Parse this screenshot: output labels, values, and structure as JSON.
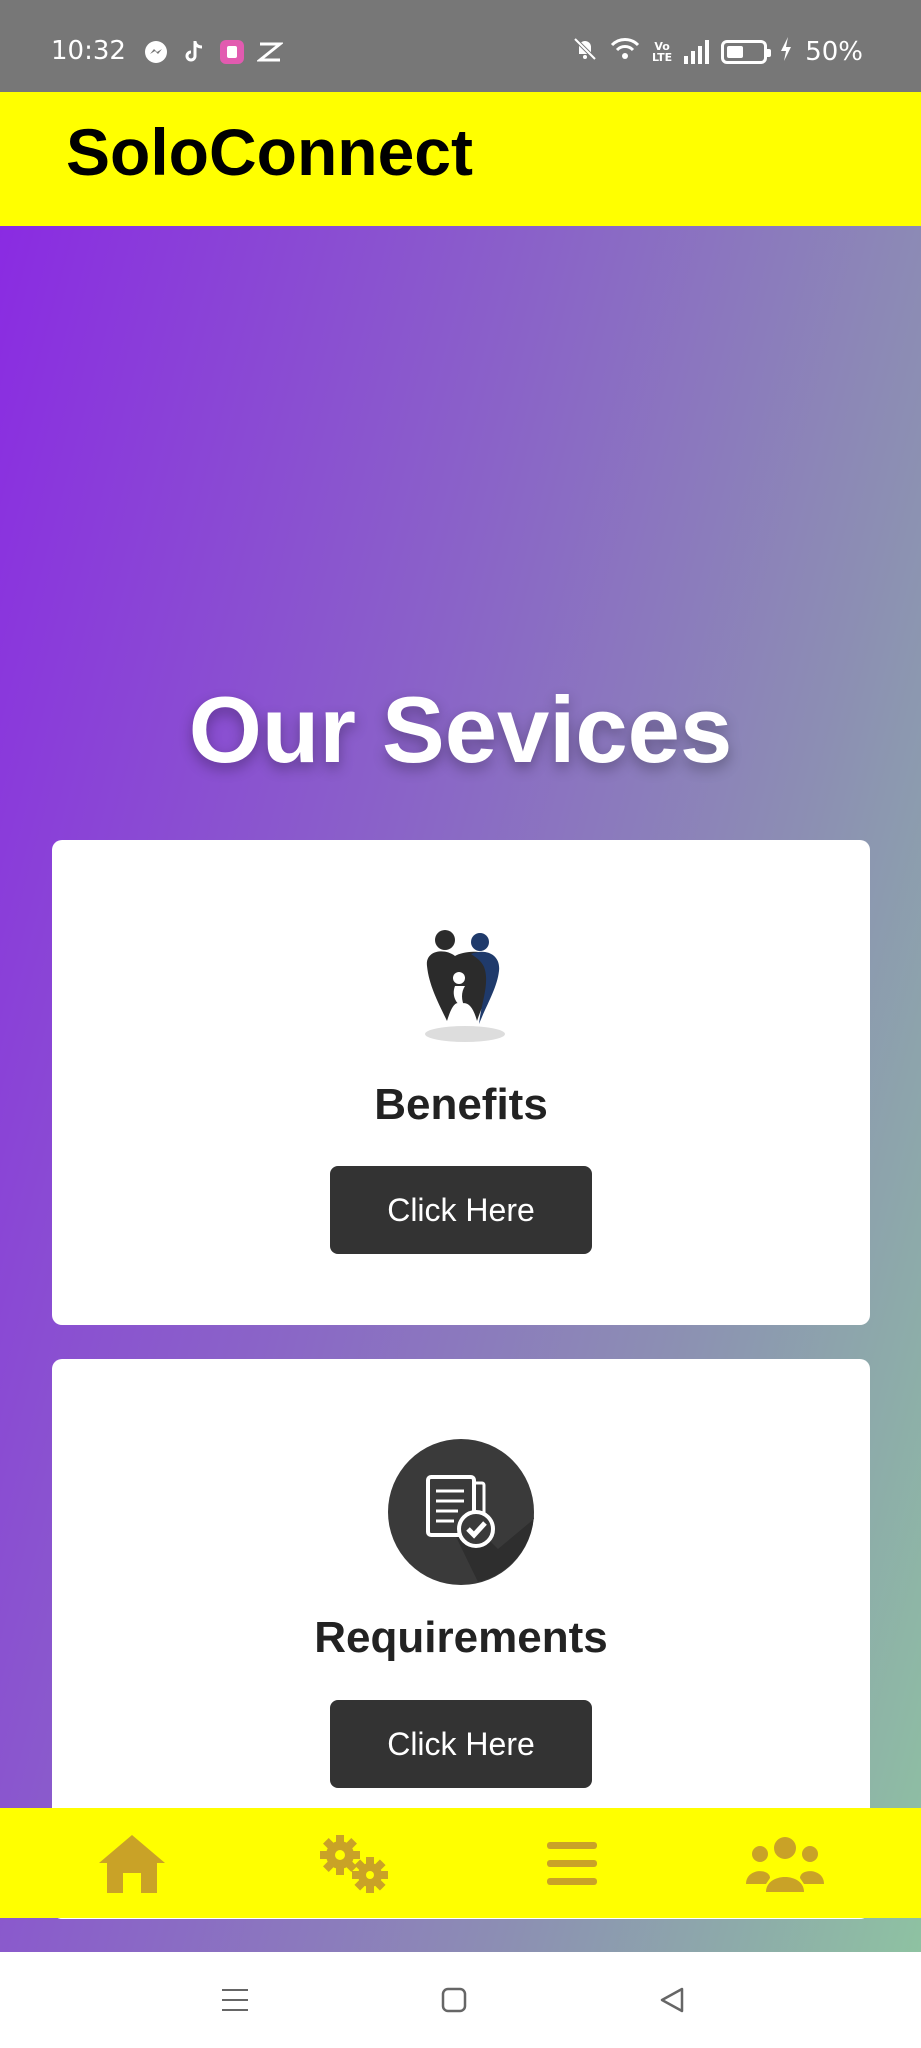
{
  "status_bar": {
    "time": "10:32",
    "battery_percent": "50%",
    "network_label": "Vo\nLTE",
    "notification_icons": [
      "messenger-icon",
      "tiktok-icon",
      "app-icon",
      "capcut-icon"
    ],
    "system_icons": [
      "mute-icon",
      "wifi-icon",
      "volte-icon",
      "signal-icon",
      "battery-icon",
      "charging-icon"
    ]
  },
  "header": {
    "title": "SoloConnect",
    "background_color": "#ffff00"
  },
  "main": {
    "section_title": "Our Sevices",
    "cards": [
      {
        "icon": "family-tooth-icon",
        "label": "Benefits",
        "button_label": "Click Here"
      },
      {
        "icon": "document-check-icon",
        "label": "Requirements",
        "button_label": "Click Here"
      }
    ]
  },
  "bottom_nav": {
    "items": [
      {
        "icon": "home-icon"
      },
      {
        "icon": "gears-icon"
      },
      {
        "icon": "menu-icon"
      },
      {
        "icon": "users-icon"
      }
    ],
    "icon_color": "#c9a227"
  },
  "system_nav": {
    "buttons": [
      "recent-apps-icon",
      "home-square-icon",
      "back-triangle-icon"
    ]
  }
}
